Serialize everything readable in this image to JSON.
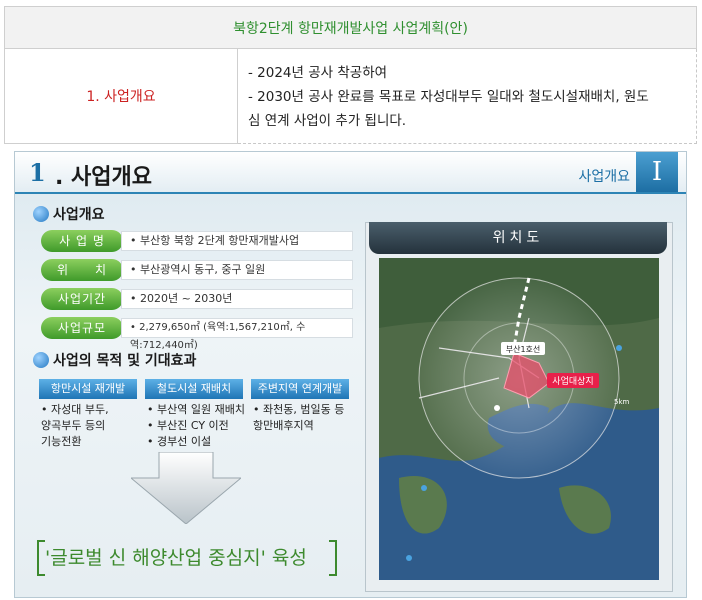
{
  "doc": {
    "header": "북항2단계 항만재개발사업 사업계획(안)",
    "label": "1. 사업개요",
    "lines": [
      "- 2024년 공사 착공하여",
      "- 2030년 공사 완료를 목표로 자성대부두 일대와 철도시설재배치, 원도",
      "심 연계 사업이 추가 됩니다."
    ]
  },
  "slide": {
    "num": "1",
    "title": ". 사업개요",
    "tag": "사업개요",
    "roman": "I",
    "overview_head": "사업개요",
    "overview": [
      {
        "label": "사 업 명",
        "value": "• 부산항 북항 2단계 항만재개발사업"
      },
      {
        "label": "위　　치",
        "value": "• 부산광역시 동구, 중구 일원"
      },
      {
        "label": "사업기간",
        "value": "• 2020년 ~ 2030년"
      },
      {
        "label": "사업규모",
        "value": "• 2,279,650㎡ (육역:1,567,210㎡, 수역:712,440㎡)"
      }
    ],
    "goal_head": "사업의 목적 및 기대효과",
    "goals": [
      {
        "title": "항만시설 재개발",
        "items": [
          "• 자성대 부두,",
          "  양곡부두 등의",
          "  기능전환"
        ]
      },
      {
        "title": "철도시설 재배치",
        "items": [
          "• 부산역 일원 재배치",
          "• 부산진 CY 이전",
          "• 경부선 이설"
        ]
      },
      {
        "title": "주변지역 연계개발",
        "items": [
          "• 좌천동, 범일동 등",
          "  항만배후지역"
        ]
      }
    ],
    "slogan": "'글로벌 신 해양산업 중심지' 육성",
    "map_title": "위치도",
    "map_labels": {
      "station": "부산1호선",
      "target": "사업대상지",
      "scale": "5km"
    }
  },
  "colors": {
    "green": "#3d8a2e",
    "blue": "#1f75b5",
    "red": "#cc2222"
  }
}
